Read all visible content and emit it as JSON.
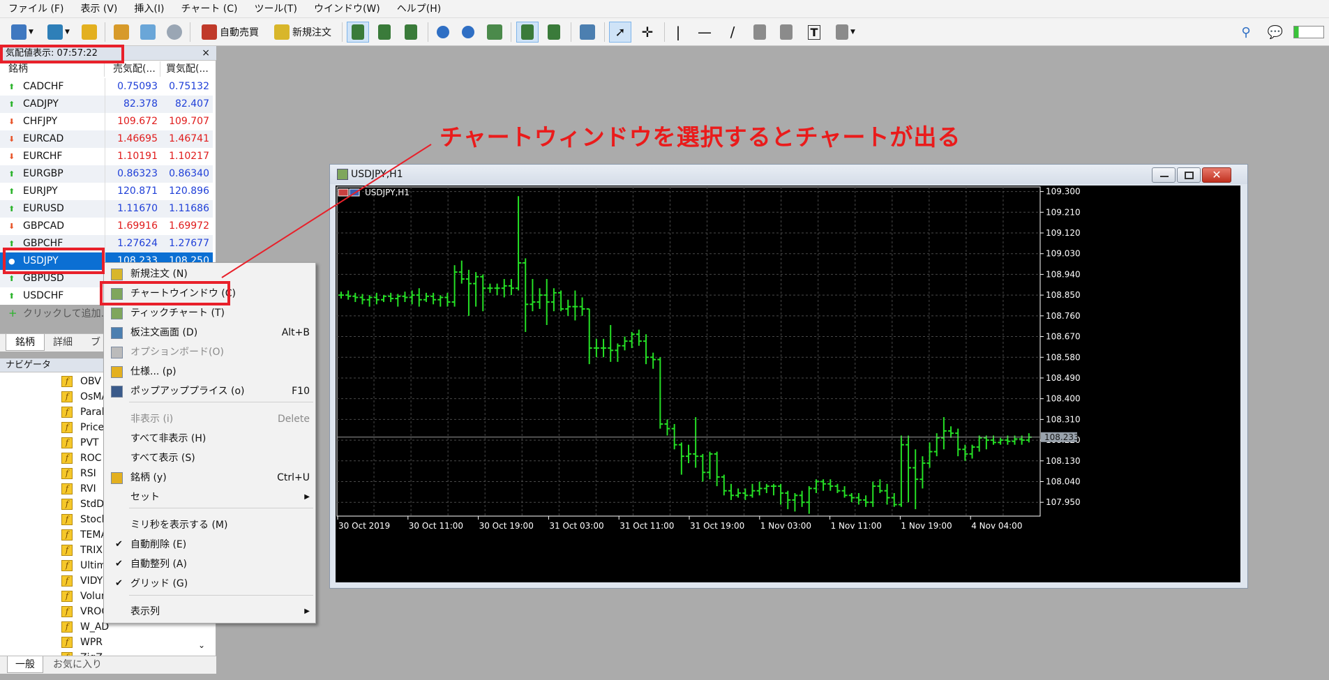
{
  "menu": [
    "ファイル (F)",
    "表示 (V)",
    "挿入(I)",
    "チャート (C)",
    "ツール(T)",
    "ウインドウ(W)",
    "ヘルプ(H)"
  ],
  "toolbar": {
    "auto_trade": "自動売買",
    "new_order": "新規注文"
  },
  "market_watch": {
    "title": "気配値表示: 07:57:22",
    "close": "×",
    "headers": [
      "銘柄",
      "売気配(...",
      "買気配(..."
    ],
    "rows": [
      {
        "symbol": "CADCHF",
        "bid": "0.75093",
        "ask": "0.75132",
        "dir": "up"
      },
      {
        "symbol": "CADJPY",
        "bid": "82.378",
        "ask": "82.407",
        "dir": "up"
      },
      {
        "symbol": "CHFJPY",
        "bid": "109.672",
        "ask": "109.707",
        "dir": "dn"
      },
      {
        "symbol": "EURCAD",
        "bid": "1.46695",
        "ask": "1.46741",
        "dir": "dn"
      },
      {
        "symbol": "EURCHF",
        "bid": "1.10191",
        "ask": "1.10217",
        "dir": "dn"
      },
      {
        "symbol": "EURGBP",
        "bid": "0.86323",
        "ask": "0.86340",
        "dir": "up"
      },
      {
        "symbol": "EURJPY",
        "bid": "120.871",
        "ask": "120.896",
        "dir": "up"
      },
      {
        "symbol": "EURUSD",
        "bid": "1.11670",
        "ask": "1.11686",
        "dir": "up"
      },
      {
        "symbol": "GBPCAD",
        "bid": "1.69916",
        "ask": "1.69972",
        "dir": "dn"
      },
      {
        "symbol": "GBPCHF",
        "bid": "1.27624",
        "ask": "1.27677",
        "dir": "up"
      },
      {
        "symbol": "USDJPY",
        "bid": "108.233",
        "ask": "108.250",
        "dir": "sel"
      },
      {
        "symbol": "GBPUSD",
        "bid": "",
        "ask": "",
        "dir": "up"
      },
      {
        "symbol": "USDCHF",
        "bid": "",
        "ask": "",
        "dir": "up"
      }
    ],
    "add_symbol": "クリックして追加...",
    "tabs": [
      "銘柄",
      "詳細",
      "ブ"
    ]
  },
  "navigator": {
    "title": "ナビゲータ",
    "items": [
      "OBV",
      "OsMA",
      "Parab",
      "Price",
      "PVT",
      "ROC",
      "RSI",
      "RVI",
      "StdD",
      "Stoch",
      "TEMA",
      "TRIX",
      "Ultim",
      "VIDY",
      "Volum",
      "VROC",
      "W_AD",
      "WPR",
      "ZigZ"
    ],
    "tabs": [
      "一般",
      "お気に入り"
    ]
  },
  "context_menu": [
    {
      "label": "新規注文 (N)",
      "shortcut": ""
    },
    {
      "label": "チャートウインドウ (C)",
      "shortcut": ""
    },
    {
      "label": "ティックチャート (T)",
      "shortcut": ""
    },
    {
      "label": "板注文画面 (D)",
      "shortcut": "Alt+B"
    },
    {
      "label": "オプションボード(O)",
      "shortcut": ""
    },
    {
      "label": "仕様... (p)",
      "shortcut": ""
    },
    {
      "label": "ポップアッププライス (o)",
      "shortcut": "F10"
    },
    {
      "label": "非表示 (i)",
      "shortcut": "Delete"
    },
    {
      "label": "すべて非表示 (H)",
      "shortcut": ""
    },
    {
      "label": "すべて表示 (S)",
      "shortcut": ""
    },
    {
      "label": "銘柄 (y)",
      "shortcut": "Ctrl+U"
    },
    {
      "label": "セット",
      "shortcut": ""
    },
    {
      "label": "ミリ秒を表示する (M)",
      "shortcut": ""
    },
    {
      "label": "自動削除 (E)",
      "shortcut": ""
    },
    {
      "label": "自動整列 (A)",
      "shortcut": ""
    },
    {
      "label": "グリッド (G)",
      "shortcut": ""
    },
    {
      "label": "表示列",
      "shortcut": ""
    }
  ],
  "annotation": "チャートウィンドウを選択するとチャートが出る",
  "chart_window": {
    "title": "USDJPY,H1",
    "inner_label": "USDJPY,H1",
    "current_price": "108.233"
  },
  "chart_data": {
    "type": "bar",
    "title": "USDJPY,H1",
    "y_ticks": [
      "109.300",
      "109.210",
      "109.120",
      "109.030",
      "108.940",
      "108.850",
      "108.760",
      "108.670",
      "108.580",
      "108.490",
      "108.400",
      "108.310",
      "108.220",
      "108.130",
      "108.040",
      "107.950"
    ],
    "x_ticks": [
      "30 Oct 2019",
      "30 Oct 11:00",
      "30 Oct 19:00",
      "31 Oct 03:00",
      "31 Oct 11:00",
      "31 Oct 19:00",
      "1 Nov 03:00",
      "1 Nov 11:00",
      "1 Nov 19:00",
      "4 Nov 04:00"
    ],
    "ylim": [
      107.89,
      109.32
    ],
    "current_price": 108.233,
    "colors": {
      "bar": "#25e025",
      "grid": "#4a4a4a",
      "bg": "#000000",
      "axis_text": "#ffffff"
    },
    "ohlc": [
      [
        108.85,
        108.865,
        108.835,
        108.85
      ],
      [
        108.85,
        108.87,
        108.83,
        108.845
      ],
      [
        108.845,
        108.86,
        108.82,
        108.84
      ],
      [
        108.84,
        108.855,
        108.81,
        108.83
      ],
      [
        108.83,
        108.85,
        108.8,
        108.84
      ],
      [
        108.84,
        108.86,
        108.81,
        108.83
      ],
      [
        108.83,
        108.85,
        108.82,
        108.845
      ],
      [
        108.845,
        108.86,
        108.82,
        108.835
      ],
      [
        108.835,
        108.855,
        108.8,
        108.845
      ],
      [
        108.845,
        108.865,
        108.82,
        108.84
      ],
      [
        108.84,
        108.87,
        108.81,
        108.85
      ],
      [
        108.85,
        108.88,
        108.8,
        108.83
      ],
      [
        108.83,
        108.86,
        108.82,
        108.845
      ],
      [
        108.845,
        108.86,
        108.81,
        108.83
      ],
      [
        108.83,
        108.85,
        108.8,
        108.84
      ],
      [
        108.84,
        108.86,
        108.8,
        108.82
      ],
      [
        108.82,
        108.98,
        108.8,
        108.95
      ],
      [
        108.95,
        109.0,
        108.9,
        108.92
      ],
      [
        108.92,
        108.96,
        108.76,
        108.9
      ],
      [
        108.9,
        108.95,
        108.8,
        108.93
      ],
      [
        108.93,
        108.94,
        108.78,
        108.88
      ],
      [
        108.88,
        108.9,
        108.86,
        108.88
      ],
      [
        108.88,
        108.9,
        108.85,
        108.88
      ],
      [
        108.88,
        108.92,
        108.84,
        108.89
      ],
      [
        108.89,
        108.92,
        108.85,
        108.88
      ],
      [
        108.88,
        109.28,
        108.87,
        108.99
      ],
      [
        108.99,
        109.01,
        108.69,
        108.81
      ],
      [
        108.81,
        108.92,
        108.78,
        108.82
      ],
      [
        108.82,
        108.88,
        108.79,
        108.85
      ],
      [
        108.85,
        108.92,
        108.72,
        108.82
      ],
      [
        108.82,
        108.88,
        108.78,
        108.86
      ],
      [
        108.86,
        108.87,
        108.78,
        108.79
      ],
      [
        108.79,
        108.83,
        108.76,
        108.8
      ],
      [
        108.8,
        108.87,
        108.74,
        108.8
      ],
      [
        108.8,
        108.84,
        108.76,
        108.79
      ],
      [
        108.79,
        108.79,
        108.55,
        108.62
      ],
      [
        108.62,
        108.66,
        108.58,
        108.62
      ],
      [
        108.62,
        108.66,
        108.58,
        108.62
      ],
      [
        108.62,
        108.72,
        108.56,
        108.61
      ],
      [
        108.61,
        108.64,
        108.56,
        108.63
      ],
      [
        108.63,
        108.67,
        108.61,
        108.65
      ],
      [
        108.65,
        108.69,
        108.62,
        108.68
      ],
      [
        108.68,
        108.7,
        108.63,
        108.65
      ],
      [
        108.65,
        108.68,
        108.55,
        108.58
      ],
      [
        108.58,
        108.6,
        108.53,
        108.57
      ],
      [
        108.57,
        108.58,
        108.27,
        108.29
      ],
      [
        108.29,
        108.31,
        108.24,
        108.27
      ],
      [
        108.27,
        108.29,
        108.18,
        108.2
      ],
      [
        108.2,
        108.21,
        108.07,
        108.15
      ],
      [
        108.15,
        108.2,
        108.12,
        108.16
      ],
      [
        108.16,
        108.32,
        108.1,
        108.15
      ],
      [
        108.15,
        108.16,
        108.04,
        108.08
      ],
      [
        108.08,
        108.17,
        108.05,
        108.16
      ],
      [
        108.16,
        108.17,
        108.02,
        108.06
      ],
      [
        108.06,
        108.07,
        107.98,
        108.0
      ],
      [
        108.0,
        108.03,
        107.96,
        107.98
      ],
      [
        107.98,
        108.01,
        107.97,
        107.99
      ],
      [
        107.99,
        108.01,
        107.96,
        107.98
      ],
      [
        107.98,
        108.03,
        107.97,
        108.0
      ],
      [
        108.0,
        108.04,
        107.98,
        108.01
      ],
      [
        108.01,
        108.03,
        107.99,
        108.02
      ],
      [
        108.02,
        108.03,
        107.98,
        108.02
      ],
      [
        108.02,
        108.03,
        107.94,
        107.99
      ],
      [
        107.99,
        108.0,
        107.92,
        107.96
      ],
      [
        107.96,
        107.99,
        107.91,
        107.98
      ],
      [
        107.98,
        108.0,
        107.93,
        107.95
      ],
      [
        107.95,
        108.02,
        107.9,
        108.01
      ],
      [
        108.01,
        108.05,
        107.99,
        108.04
      ],
      [
        108.04,
        108.05,
        108.0,
        108.03
      ],
      [
        108.03,
        108.05,
        108.0,
        108.02
      ],
      [
        108.02,
        108.03,
        107.99,
        108.0
      ],
      [
        108.0,
        108.02,
        107.97,
        107.98
      ],
      [
        107.98,
        107.99,
        107.95,
        107.97
      ],
      [
        107.97,
        107.99,
        107.94,
        107.96
      ],
      [
        107.96,
        107.98,
        107.93,
        107.95
      ],
      [
        107.95,
        108.04,
        107.93,
        108.02
      ],
      [
        108.02,
        108.05,
        107.99,
        108.0
      ],
      [
        108.0,
        108.03,
        107.94,
        107.97
      ],
      [
        107.97,
        107.99,
        107.93,
        107.94
      ],
      [
        107.94,
        108.24,
        107.93,
        108.2
      ],
      [
        108.2,
        108.24,
        107.95,
        108.1
      ],
      [
        108.1,
        108.18,
        107.92,
        108.05
      ],
      [
        108.05,
        108.15,
        108.01,
        108.12
      ],
      [
        108.12,
        108.21,
        108.1,
        108.17
      ],
      [
        108.17,
        108.25,
        108.15,
        108.23
      ],
      [
        108.23,
        108.32,
        108.18,
        108.26
      ],
      [
        108.26,
        108.28,
        108.23,
        108.25
      ],
      [
        108.25,
        108.27,
        108.15,
        108.18
      ],
      [
        108.18,
        108.2,
        108.13,
        108.16
      ],
      [
        108.16,
        108.2,
        108.14,
        108.19
      ],
      [
        108.19,
        108.24,
        108.17,
        108.23
      ],
      [
        108.23,
        108.24,
        108.18,
        108.22
      ],
      [
        108.22,
        108.24,
        108.2,
        108.21
      ],
      [
        108.21,
        108.23,
        108.2,
        108.22
      ],
      [
        108.22,
        108.24,
        108.2,
        108.215
      ],
      [
        108.215,
        108.24,
        108.2,
        108.225
      ],
      [
        108.225,
        108.24,
        108.2,
        108.22
      ],
      [
        108.22,
        108.25,
        108.21,
        108.233
      ]
    ]
  }
}
